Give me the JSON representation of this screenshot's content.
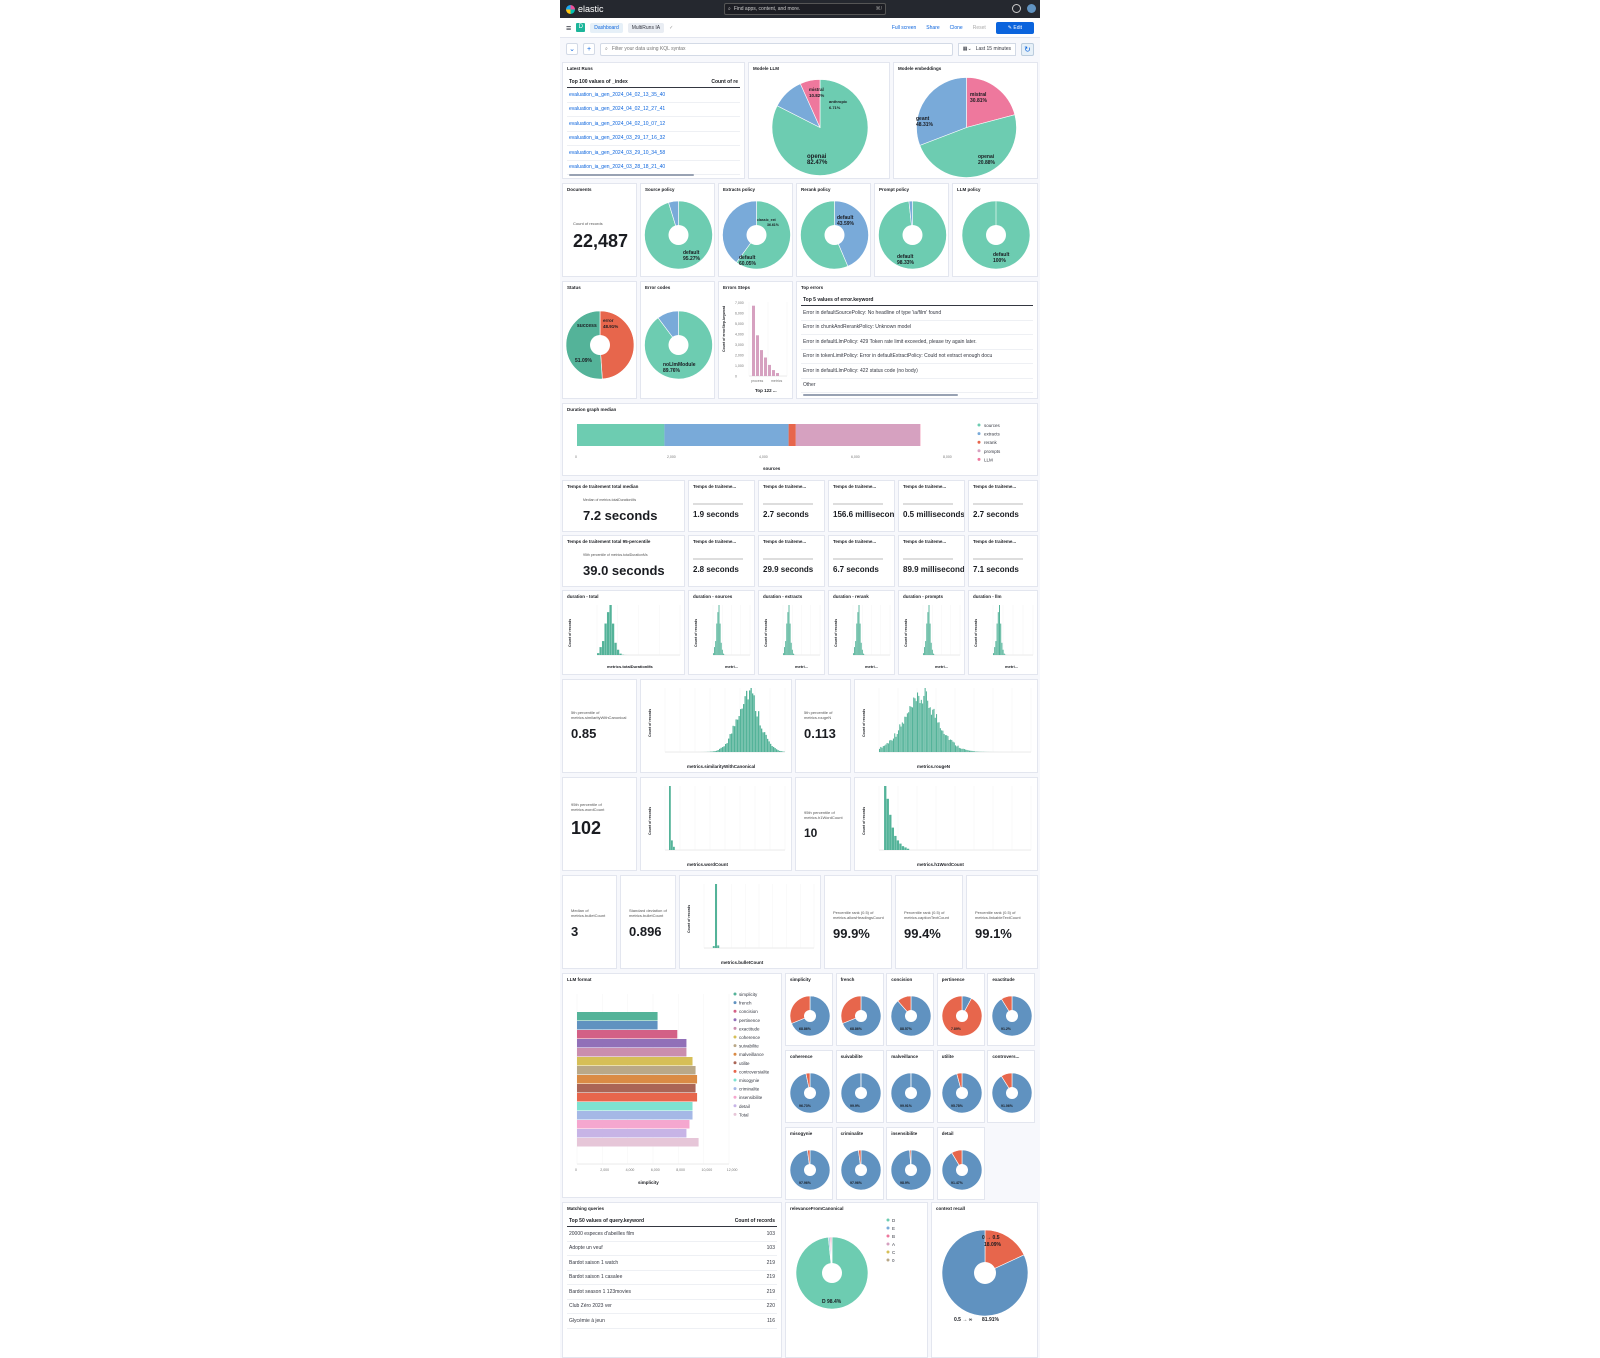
{
  "app": {
    "name": "elastic",
    "search_placeholder": "Find apps, content, and more.",
    "search_kbd": "⌘/"
  },
  "nav": {
    "breadcrumb_1": "Dashboard",
    "breadcrumb_2": "MultiRuns IA",
    "fullscreen": "Full screen",
    "share": "Share",
    "clone": "Clone",
    "reset": "Reset",
    "edit": "Edit"
  },
  "query": {
    "placeholder": "Filter your data using KQL syntax",
    "time": "Last 15 minutes"
  },
  "colors": {
    "green": "#6dccb1",
    "blue": "#79aad9",
    "pink": "#ee789d",
    "mauve": "#d6a1c0",
    "red": "#e7664c",
    "dkgreen": "#54b399",
    "steel": "#6092c0"
  },
  "latest_runs": {
    "title": "Latest Runs",
    "col1": "Top 100 values of _index",
    "col2": "Count of re",
    "rows": [
      "evaluation_ia_gen_2024_04_02_13_35_40",
      "evaluation_ia_gen_2024_04_02_12_27_41",
      "evaluation_ia_gen_2024_04_02_10_07_12",
      "evaluation_ia_gen_2024_03_29_17_16_32",
      "evaluation_ia_gen_2024_03_29_10_34_58",
      "evaluation_ia_gen_2024_03_28_18_21_40"
    ]
  },
  "modele_llm": {
    "title": "Modele LLM",
    "slices": [
      {
        "label": "openai",
        "value": 82.47,
        "pct": "82.47%"
      },
      {
        "label": "mistral",
        "value": 10.82,
        "pct": "10.82%"
      },
      {
        "label": "anthropic",
        "value": 6.71,
        "pct": "6.71%"
      }
    ]
  },
  "modele_emb": {
    "title": "Modele embeddings",
    "slices": [
      {
        "label": "openai",
        "value": 20.88,
        "pct": "20.88%"
      },
      {
        "label": "geant",
        "value": 48.31,
        "pct": "48.31%"
      },
      {
        "label": "mistral",
        "value": 30.81,
        "pct": "30.81%"
      }
    ]
  },
  "documents": {
    "title": "Documents",
    "label": "Count of records",
    "value": "22,487"
  },
  "source_policy": {
    "title": "Source policy",
    "label": "default",
    "pct": "95.27%",
    "value": 95.27
  },
  "extracts_policy": {
    "title": "Extracts policy",
    "label": "default",
    "pct": "60.05%",
    "value": 60.05,
    "label2": "classic_ext",
    "pct2": "36.61%"
  },
  "rerank_policy": {
    "title": "Rerank policy",
    "label": "default",
    "pct": "43.59%",
    "value": 43.59
  },
  "prompt_policy": {
    "title": "Prompt policy",
    "label": "default",
    "pct": "98.33%",
    "value": 98.33
  },
  "llm_policy": {
    "title": "LLM policy",
    "label": "default",
    "pct": "100%",
    "value": 100
  },
  "status": {
    "title": "Status",
    "l1": "success",
    "p1": "51.09%",
    "l2": "error",
    "p2": "48.91%",
    "v1": 51.09
  },
  "error_codes": {
    "title": "Error codes",
    "label": "noLlmModule",
    "pct": "89.76%",
    "value": 89.76
  },
  "errors_steps": {
    "title": "Errors Steps",
    "ylabel": "Count of errorStep.keyword",
    "xlabel": "Top 122 ...",
    "ticks": [
      "7,000",
      "6,000",
      "5,000",
      "4,000",
      "3,000",
      "2,000",
      "1,000",
      "0"
    ],
    "cats": [
      "process",
      "metrics"
    ]
  },
  "top_errors": {
    "title": "Top errors",
    "header": "Top 5 values of error.keyword",
    "rows": [
      "Error in defaultSourcePolicy: No headline of type 'ia/film' found",
      "Error in chunkAndRerankPolicy: Unknown model",
      "Error in defaultLlmPolicy: 429 Token rate limit exceeded, please try again later.",
      "Error in tokenLimitPolicy: Error in defaultExtractPolicy: Could not extract enough docu",
      "Error in defaultLlmPolicy: 422 status code (no body)",
      "Other"
    ]
  },
  "duration_graph": {
    "title": "Duration graph median",
    "xlabel": "sources",
    "ticks": [
      "0",
      "2,000",
      "4,000",
      "6,000",
      "8,000"
    ],
    "legend": [
      "sources",
      "extracts",
      "rerank",
      "prompts",
      "LLM"
    ],
    "values": [
      1900,
      2700,
      156.6,
      2700,
      0.5
    ],
    "max": 8000
  },
  "median_row": {
    "main_title": "Temps de traitement total median",
    "main_label": "Median of metrics.totalDurationMs",
    "main_value": "7.2 seconds",
    "cells": [
      {
        "title": "Temps de traiteme...",
        "value": "1.9 seconds"
      },
      {
        "title": "Temps de traiteme...",
        "value": "2.7 seconds"
      },
      {
        "title": "Temps de traiteme...",
        "value": "156.6 milliseconds"
      },
      {
        "title": "Temps de traiteme...",
        "value": "0.5 milliseconds"
      },
      {
        "title": "Temps de traiteme...",
        "value": "2.7 seconds"
      }
    ]
  },
  "p95_row": {
    "main_title": "Temps de traitement total 95-percentile",
    "main_label": "95th percentile of metrics.totalDurationMs",
    "main_value": "39.0 seconds",
    "cells": [
      {
        "title": "Temps de traiteme...",
        "value": "2.8 seconds"
      },
      {
        "title": "Temps de traiteme...",
        "value": "29.9 seconds"
      },
      {
        "title": "Temps de traiteme...",
        "value": "6.7 seconds"
      },
      {
        "title": "Temps de traiteme...",
        "value": "89.9 milliseconds"
      },
      {
        "title": "Temps de traiteme...",
        "value": "7.1 seconds"
      }
    ]
  },
  "durations": [
    {
      "title": "duration - total",
      "xlabel": "metrics.totalDurationMs"
    },
    {
      "title": "duration - sources",
      "xlabel": "metri..."
    },
    {
      "title": "duration - extracts",
      "xlabel": "metri..."
    },
    {
      "title": "duration - rerank",
      "xlabel": "metri..."
    },
    {
      "title": "duration - prompts",
      "xlabel": "metri..."
    },
    {
      "title": "duration - llm",
      "xlabel": "metri..."
    }
  ],
  "similarity": {
    "label": "5th percentile of metrics.similarityWithCanonical",
    "value": "0.85",
    "xlabel": "metrics.similarityWithCanonical",
    "ylabel": "Count of records"
  },
  "rouge": {
    "label": "5th percentile of metrics.rougeN",
    "value": "0.113",
    "xlabel": "metrics.rougeN",
    "ylabel": "Count of records"
  },
  "wordcount": {
    "label": "95th percentile of metrics.wordCount",
    "value": "102",
    "xlabel": "metrics.wordCount",
    "ylabel": "Count of records"
  },
  "h1wordcount": {
    "label": "95th percentile of metrics.h1WordCount",
    "value": "10",
    "xlabel": "metrics.h1WordCount",
    "ylabel": "Count of records"
  },
  "bullet": {
    "median_label": "Median of metrics.bulletCount",
    "median_value": "3",
    "std_label": "Standard deviation of metrics.bulletCount",
    "std_value": "0.896",
    "xlabel": "metrics.bulletCount",
    "ylabel": "Count of records"
  },
  "pct_rank": [
    {
      "label": "Percentile rank (0.5) of metrics.allowHeadingsCount",
      "value": "99.9%"
    },
    {
      "label": "Percentile rank (0.5) of metrics.captionTextCount",
      "value": "99.4%"
    },
    {
      "label": "Percentile rank (0.5) of metrics.linkableTextCount",
      "value": "99.1%"
    }
  ],
  "llm_format": {
    "title": "LLM format",
    "xlabel": "simplicity",
    "ticks": [
      "0",
      "2,000",
      "4,000",
      "6,000",
      "8,000",
      "10,000",
      "12,000"
    ],
    "legend": [
      "simplicity",
      "french",
      "concision",
      "pertinence",
      "exactitude",
      "coherence",
      "suivabilite",
      "malveillance",
      "utilite",
      "controversialite",
      "misogynie",
      "criminalite",
      "insensibilite",
      "detail",
      "Total"
    ]
  },
  "format_pies": [
    {
      "title": "simplicity",
      "pct": "68.86%"
    },
    {
      "title": "french",
      "pct": "68.86%"
    },
    {
      "title": "concision",
      "pct": "88.57%"
    },
    {
      "title": "pertinence",
      "pct": "7.89%"
    },
    {
      "title": "exactitude",
      "pct": "91.2%"
    },
    {
      "title": "coherence",
      "pct": "96.73%"
    },
    {
      "title": "suivabilite",
      "pct": "99.9%"
    },
    {
      "title": "malveillance",
      "pct": "99.91%"
    },
    {
      "title": "utilite",
      "pct": "95.78%"
    },
    {
      "title": "controvers...",
      "pct": "91.06%"
    },
    {
      "title": "misogynie",
      "pct": "97.96%"
    },
    {
      "title": "criminalite",
      "pct": "97.96%"
    },
    {
      "title": "insensibilite",
      "pct": "98.9%"
    },
    {
      "title": "detail",
      "pct": "91.47%"
    }
  ],
  "matching": {
    "title": "Matching queries",
    "col1": "Top 50 values of query.keyword",
    "col2": "Count of records",
    "rows": [
      {
        "q": "20000 especes d'abeilles film",
        "c": "103"
      },
      {
        "q": "Adopte un veuf",
        "c": "103"
      },
      {
        "q": "Bardot saison 1 watch",
        "c": "219"
      },
      {
        "q": "Bardot saison 1 casalee",
        "c": "219"
      },
      {
        "q": "Bardot season 1 123movies",
        "c": "219"
      },
      {
        "q": "Club Zéro 2023 ver",
        "c": "220"
      },
      {
        "q": "Glycémie à jeun",
        "c": "116"
      }
    ]
  },
  "relevance": {
    "title": "relevanceFromCanonical",
    "main": "D 98.4%",
    "legend": [
      "D",
      "E",
      "B",
      "A",
      "C",
      "0"
    ]
  },
  "context_recall": {
    "title": "context recall",
    "l1": "0 → 0.5",
    "p1": "18.09%",
    "l2": "0.5 → ∞",
    "p2": "81.91%",
    "v1": 18.09
  }
}
